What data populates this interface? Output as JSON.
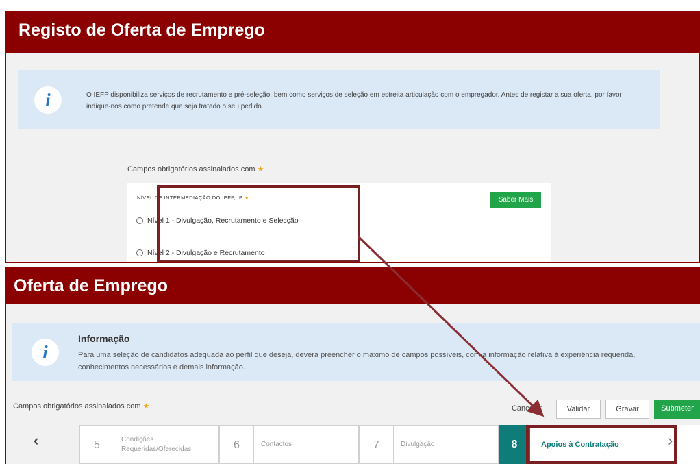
{
  "top_panel": {
    "title": "Registo de Oferta de Emprego",
    "info_icon": "info-icon",
    "info_text": "O IEFP disponibiliza serviços de recrutamento e pré-seleção, bem como serviços de seleção em estreita articulação com o empregador. Antes de registar a sua oferta, por favor indique-nos como pretende que seja tratado o seu pedido.",
    "required_note": "Campos obrigatórios assinalados com",
    "field_label": "NÍVEL DE INTERMEDIAÇÃO DO IEFP, IP",
    "saber_mais": "Saber Mais",
    "options": [
      "Nível 1 - Divulgação, Recrutamento e Selecção",
      "Nível 2 - Divulgação e Recrutamento"
    ]
  },
  "bottom_panel": {
    "title": "Oferta de Emprego",
    "info_icon": "info-icon",
    "info_title": "Informação",
    "info_text": "Para uma seleção de candidatos adequada ao perfil que deseja, deverá preencher o máximo de campos possíveis, com a informação relativa à experiência requerida, conhecimentos necessários e demais informação.",
    "required_note": "Campos obrigatórios assinalados com",
    "buttons": {
      "cancel": "Cancelar",
      "validate": "Validar",
      "save": "Gravar",
      "submit": "Submeter"
    },
    "steps": [
      {
        "num": "5",
        "label": "Condições Requeridas/Oferecidas"
      },
      {
        "num": "6",
        "label": "Contactos"
      },
      {
        "num": "7",
        "label": "Divulgação"
      },
      {
        "num": "8",
        "label": "Apoios à Contratação"
      }
    ],
    "prev_icon": "chevron-left-icon",
    "next_icon": "chevron-right-icon"
  },
  "colors": {
    "header_bar": "#8b0000",
    "info_bg": "#dbe9f7",
    "green_button": "#22a54a",
    "active_step": "#0e7c78",
    "annotation": "#7a1f22"
  }
}
